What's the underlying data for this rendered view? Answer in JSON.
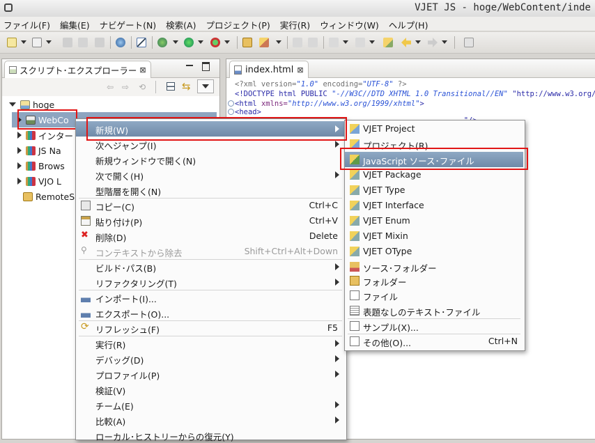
{
  "window": {
    "title": "VJET JS - hoge/WebContent/inde"
  },
  "menubar": [
    "ファイル(F)",
    "編集(E)",
    "ナビゲート(N)",
    "検索(A)",
    "プロジェクト(P)",
    "実行(R)",
    "ウィンドウ(W)",
    "ヘルプ(H)"
  ],
  "left_view": {
    "tab_label": "スクリプト･エクスプローラー",
    "tree": [
      {
        "label": "hoge",
        "icon": "project-icon",
        "expanded": true
      },
      {
        "label": "WebCo",
        "icon": "webcontent-icon",
        "selected": true
      },
      {
        "label": "インター",
        "icon": "library-icon"
      },
      {
        "label": "JS Na",
        "icon": "library-icon"
      },
      {
        "label": "Brows",
        "icon": "library-icon"
      },
      {
        "label": "VJO L",
        "icon": "library-icon"
      },
      {
        "label": "RemoteS",
        "icon": "folder-icon"
      }
    ]
  },
  "editor": {
    "tab_label": "index.html",
    "lines": [
      {
        "parts": [
          [
            "pi",
            "<?xml version="
          ],
          [
            "str",
            "\"1.0\""
          ],
          [
            "pi",
            " encoding="
          ],
          [
            "str",
            "\"UTF-8\""
          ],
          [
            "pi",
            " ?>"
          ]
        ]
      },
      {
        "parts": [
          [
            "tag",
            "<!DOCTYPE html PUBLIC "
          ],
          [
            "str",
            "\"-//W3C//DTD XHTML 1.0 Transitional//EN\""
          ],
          [
            "tag",
            " \"http://www.w3.org/"
          ]
        ]
      },
      {
        "parts": [
          [
            "tag",
            "<html "
          ],
          [
            "attr",
            "xmlns="
          ],
          [
            "str",
            "\"http://www.w3.org/1999/xhtml\""
          ],
          [
            "tag",
            ">"
          ]
        ]
      },
      {
        "parts": [
          [
            "tag",
            "<head>"
          ]
        ]
      },
      {
        "parts": [
          [
            "tag",
            "                                                    \"/>"
          ]
        ]
      }
    ]
  },
  "context_menu": {
    "items": [
      {
        "label": "新規(W)",
        "submenu": true,
        "highlighted": true
      },
      {
        "label": "次へジャンプ(I)",
        "submenu": true
      },
      {
        "label": "新規ウィンドウで開く(N)"
      },
      {
        "label": "次で開く(H)",
        "submenu": true
      },
      {
        "label": "型階層を開く(N)"
      },
      {
        "label": "コピー(C)",
        "shortcut": "Ctrl+C",
        "icon": "copy-icon"
      },
      {
        "label": "貼り付け(P)",
        "shortcut": "Ctrl+V",
        "icon": "paste-icon"
      },
      {
        "label": "削除(D)",
        "shortcut": "Delete",
        "icon": "delete-icon"
      },
      {
        "label": "コンテキストから除去",
        "shortcut": "Shift+Ctrl+Alt+Down",
        "icon": "remove-context-icon",
        "disabled": true
      },
      {
        "label": "ビルド･パス(B)",
        "submenu": true
      },
      {
        "label": "リファクタリング(T)",
        "submenu": true
      },
      {
        "label": "インポート(I)...",
        "icon": "import-icon"
      },
      {
        "label": "エクスポート(O)...",
        "icon": "export-icon"
      },
      {
        "label": "リフレッシュ(F)",
        "shortcut": "F5",
        "icon": "refresh-icon"
      },
      {
        "label": "実行(R)",
        "submenu": true
      },
      {
        "label": "デバッグ(D)",
        "submenu": true
      },
      {
        "label": "プロファイル(P)",
        "submenu": true
      },
      {
        "label": "検証(V)"
      },
      {
        "label": "チーム(E)",
        "submenu": true
      },
      {
        "label": "比較(A)",
        "submenu": true
      },
      {
        "label": "ローカル･ヒストリーからの復元(Y)"
      }
    ]
  },
  "new_submenu": {
    "items": [
      {
        "label": "VJET Project",
        "icon": "vjet-project-icon"
      },
      {
        "label": "プロジェクト(R)...",
        "icon": "project-wizard-icon"
      },
      {
        "label": "JavaScript ソース･ファイル",
        "icon": "js-source-icon",
        "highlighted": true
      },
      {
        "label": "VJET Package",
        "icon": "vjet-package-icon"
      },
      {
        "label": "VJET Type",
        "icon": "vjet-type-icon"
      },
      {
        "label": "VJET Interface",
        "icon": "vjet-interface-icon"
      },
      {
        "label": "VJET Enum",
        "icon": "vjet-enum-icon"
      },
      {
        "label": "VJET Mixin",
        "icon": "vjet-mixin-icon"
      },
      {
        "label": "VJET OType",
        "icon": "vjet-otype-icon"
      },
      {
        "label": "ソース･フォルダー",
        "icon": "source-folder-icon"
      },
      {
        "label": "フォルダー",
        "icon": "folder-icon"
      },
      {
        "label": "ファイル",
        "icon": "file-icon"
      },
      {
        "label": "表題なしのテキスト･ファイル",
        "icon": "text-file-icon"
      },
      {
        "label": "サンプル(X)...",
        "icon": "sample-icon"
      },
      {
        "label": "その他(O)...",
        "shortcut": "Ctrl+N",
        "icon": "other-icon"
      }
    ]
  },
  "colors": {
    "highlight": "#7d97b5",
    "annotation_red": "#e11515",
    "editor_tag": "#2a2aa8",
    "editor_string": "#2a52d6"
  }
}
